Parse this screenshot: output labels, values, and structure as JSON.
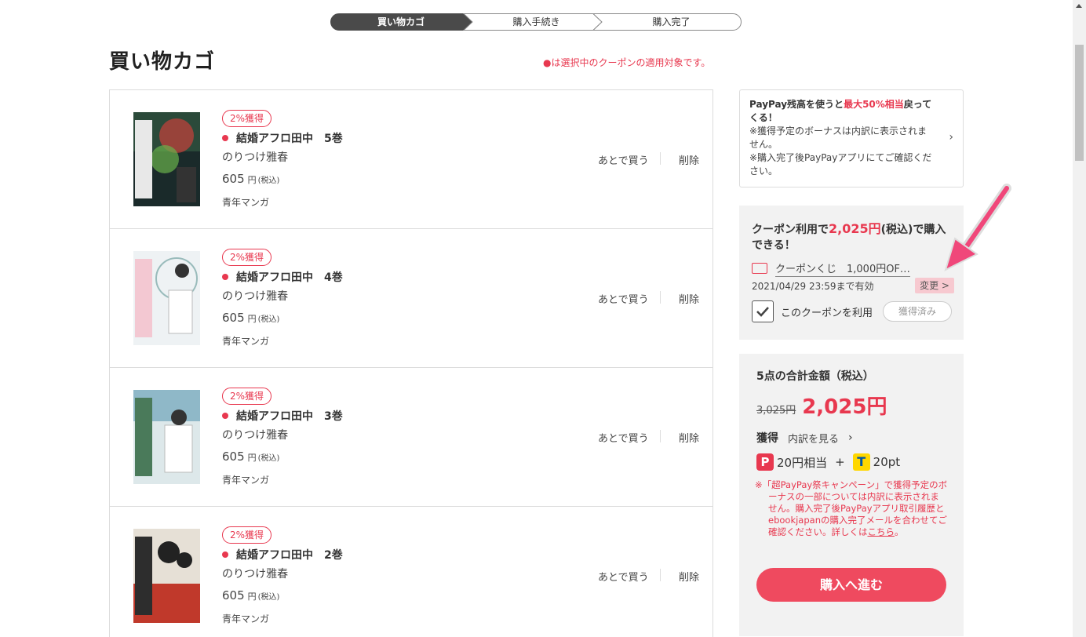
{
  "stepper": {
    "steps": [
      "買い物カゴ",
      "購入手続き",
      "購入完了"
    ]
  },
  "page_title": "買い物カゴ",
  "coupon_note": "●は選択中のクーポンの適用対象です。",
  "cart_items": [
    {
      "badge": "2%獲得",
      "title": "結婚アフロ田中　5巻",
      "author": "のりつけ雅春",
      "price": "605",
      "yen": "円",
      "tax": "(税込)",
      "genre": "青年マンガ",
      "later": "あとで買う",
      "delete": "削除"
    },
    {
      "badge": "2%獲得",
      "title": "結婚アフロ田中　4巻",
      "author": "のりつけ雅春",
      "price": "605",
      "yen": "円",
      "tax": "(税込)",
      "genre": "青年マンガ",
      "later": "あとで買う",
      "delete": "削除"
    },
    {
      "badge": "2%獲得",
      "title": "結婚アフロ田中　3巻",
      "author": "のりつけ雅春",
      "price": "605",
      "yen": "円",
      "tax": "(税込)",
      "genre": "青年マンガ",
      "later": "あとで買う",
      "delete": "削除"
    },
    {
      "badge": "2%獲得",
      "title": "結婚アフロ田中　2巻",
      "author": "のりつけ雅春",
      "price": "605",
      "yen": "円",
      "tax": "(税込)",
      "genre": "青年マンガ",
      "later": "あとで買う",
      "delete": "削除"
    }
  ],
  "paypay_box": {
    "line1_a": "PayPay残高を使うと",
    "line1_hl": "最大50%相当",
    "line1_b": "戻ってくる！",
    "note1": "※獲得予定のボーナスは内訳に表示されません。",
    "note2": "※購入完了後PayPayアプリにてご確認ください。"
  },
  "coupon": {
    "head_a": "クーポン利用で",
    "head_hl": "2,025円",
    "head_b": "(税込)で購入できる！",
    "name": "クーポンくじ　1,000円OF…",
    "expiry": "2021/04/29 23:59まで有効",
    "change": "変更 >",
    "use_label": "このクーポンを利用",
    "acquired": "獲得済み"
  },
  "total": {
    "label": "5点の合計金額（税込）",
    "original": "3,025円",
    "price": "2,025円",
    "earn_label": "獲得",
    "breakdown": "内訳を見る",
    "paypay_points": "20円相当",
    "plus": "+",
    "t_points": "20pt",
    "campaign_note": "※「超PayPay祭キャンペーン」で獲得予定のボーナスの一部については内訳に表示されません。購入完了後PayPayアプリ取引履歴とebookjapanの購入完了メールを合わせてご確認ください。詳しくは",
    "campaign_link": "こちら",
    "campaign_end": "。",
    "checkout": "購入へ進む"
  },
  "colors": {
    "accent": "#e8384f",
    "stepper_active": "#4a4a4a",
    "panel_bg": "#f2f2f2"
  }
}
